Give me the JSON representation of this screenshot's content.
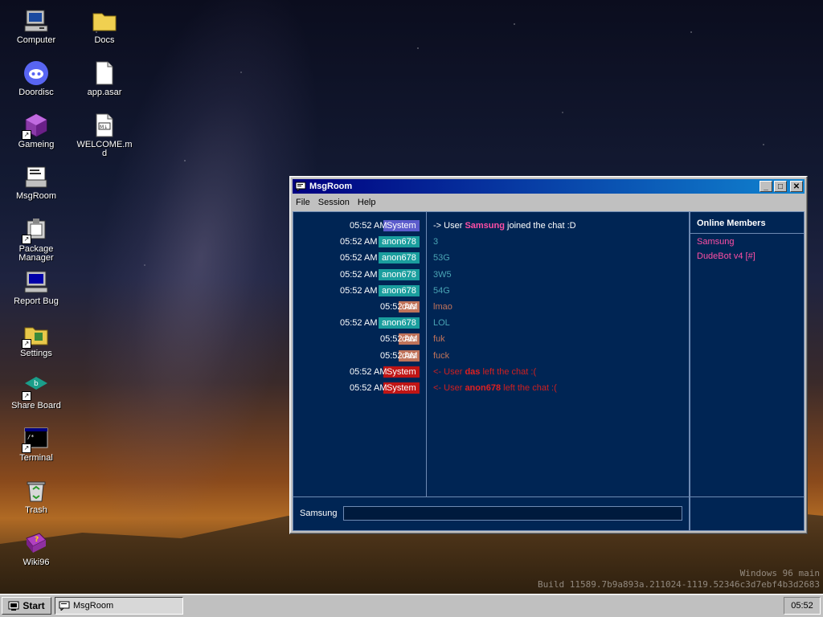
{
  "desktop": {
    "icons": [
      {
        "label": "Computer"
      },
      {
        "label": "Doordisc"
      },
      {
        "label": "Gameing"
      },
      {
        "label": "MsgRoom"
      },
      {
        "label": "Package Manager"
      },
      {
        "label": "Report Bug"
      },
      {
        "label": "Settings"
      },
      {
        "label": "Share Board"
      },
      {
        "label": "Terminal"
      },
      {
        "label": "Trash"
      },
      {
        "label": "Wiki96"
      },
      {
        "label": "Docs"
      },
      {
        "label": "app.asar"
      },
      {
        "label": "WELCOME.md"
      }
    ],
    "watermark": {
      "line1": "Windows 96 main",
      "line2": "Build 11589.7b9a893a.211024-1119.52346c3d7ebf4b3d2683"
    }
  },
  "window": {
    "title": "MsgRoom",
    "menu": [
      "File",
      "Session",
      "Help"
    ],
    "messages": [
      {
        "time": "05:52 AM",
        "nick": "System",
        "nick_color": "#5c5ccc",
        "prefix": "-> User ",
        "user": "Samsung",
        "suffix": " joined the chat :D",
        "text_color": "#ffffff",
        "user_color": "#ff4fa5"
      },
      {
        "time": "05:52 AM",
        "nick": "anon678",
        "nick_color": "#1a9e9e",
        "text": "3",
        "text_color": "#4aa5b5"
      },
      {
        "time": "05:52 AM",
        "nick": "anon678",
        "nick_color": "#1a9e9e",
        "text": "53G",
        "text_color": "#4aa5b5"
      },
      {
        "time": "05:52 AM",
        "nick": "anon678",
        "nick_color": "#1a9e9e",
        "text": "3W5",
        "text_color": "#4aa5b5"
      },
      {
        "time": "05:52 AM",
        "nick": "anon678",
        "nick_color": "#1a9e9e",
        "text": "54G",
        "text_color": "#4aa5b5"
      },
      {
        "time": "05:52 AM",
        "nick": "das",
        "nick_color": "#c0735a",
        "text": "lmao",
        "text_color": "#c0735a"
      },
      {
        "time": "05:52 AM",
        "nick": "anon678",
        "nick_color": "#1a9e9e",
        "text": "LOL",
        "text_color": "#4aa5b5"
      },
      {
        "time": "05:52 AM",
        "nick": "das",
        "nick_color": "#c0735a",
        "text": "fuk",
        "text_color": "#c0735a"
      },
      {
        "time": "05:52 AM",
        "nick": "das",
        "nick_color": "#c0735a",
        "text": "fuck",
        "text_color": "#c0735a"
      },
      {
        "time": "05:52 AM",
        "nick": "System",
        "nick_color": "#c01515",
        "prefix": "<- User ",
        "user": "das",
        "suffix": " left the chat :(",
        "text_color": "#d02020",
        "user_color": "#e02020"
      },
      {
        "time": "05:52 AM",
        "nick": "System",
        "nick_color": "#c01515",
        "prefix": "<- User ",
        "user": "anon678",
        "suffix": " left the chat :(",
        "text_color": "#d02020",
        "user_color": "#e02020"
      }
    ],
    "members_title": "Online Members",
    "members": [
      "Samsung",
      "DudeBot v4 [#]"
    ],
    "input_user": "Samsung",
    "input_value": ""
  },
  "taskbar": {
    "start_label": "Start",
    "task_label": "MsgRoom",
    "clock": "05:52"
  }
}
